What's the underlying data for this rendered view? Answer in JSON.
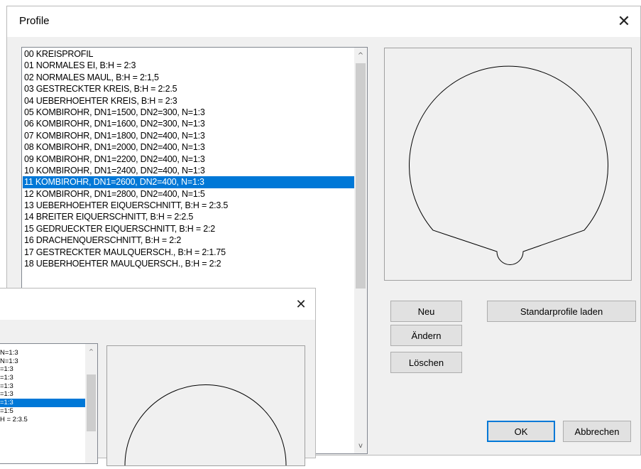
{
  "dialog": {
    "title": "Profile",
    "close_glyph": "✕"
  },
  "list": {
    "items": [
      "00 KREISPROFIL",
      "01 NORMALES EI,  B:H = 2:3",
      "02 NORMALES MAUL,          B:H = 2:1,5",
      "03 GESTRECKTER KREIS, B:H = 2:2.5",
      "04 UEBERHOEHTER KREIS, B:H = 2:3",
      "05 KOMBIROHR, DN1=1500, DN2=300, N=1:3",
      "06 KOMBIROHR, DN1=1600, DN2=300, N=1:3",
      "07 KOMBIROHR, DN1=1800, DN2=400, N=1:3",
      "08 KOMBIROHR, DN1=2000, DN2=400, N=1:3",
      "09 KOMBIROHR, DN1=2200, DN2=400, N=1:3",
      "10 KOMBIROHR, DN1=2400, DN2=400, N=1:3",
      "11 KOMBIROHR, DN1=2600, DN2=400, N=1:3",
      "12 KOMBIROHR, DN1=2800, DN2=400, N=1:5",
      "13 UEBERHOEHTER EIQUERSCHNITT, B:H = 2:3.5",
      "14 BREITER EIQUERSCHNITT, B:H = 2:2.5",
      "15 GEDRUECKTER EIQUERSCHNITT, B:H = 2:2",
      "16 DRACHENQUERSCHNITT, B:H = 2:2",
      "17 GESTRECKTER MAULQUERSCH., B:H = 2:1.75",
      "18 UEBERHOEHTER MAULQUERSCH., B:H = 2:2"
    ],
    "selected_index": 11,
    "scroll_up_glyph": "^",
    "scroll_down_glyph": "v"
  },
  "buttons": {
    "new": "Neu",
    "edit": "Ändern",
    "delete": "Löschen",
    "load_standard": "Standarprofile laden",
    "ok": "OK",
    "cancel": "Abbrechen"
  },
  "background_dialog": {
    "close_glyph": "✕",
    "list_fragments": [
      "N=1:3",
      "N=1:3",
      "=1:3",
      "=1:3",
      "=1:3",
      "=1:3",
      "=1:3",
      "=1:5",
      "H = 2:3.5"
    ],
    "selected_index": 6,
    "scroll_up_glyph": "^"
  }
}
